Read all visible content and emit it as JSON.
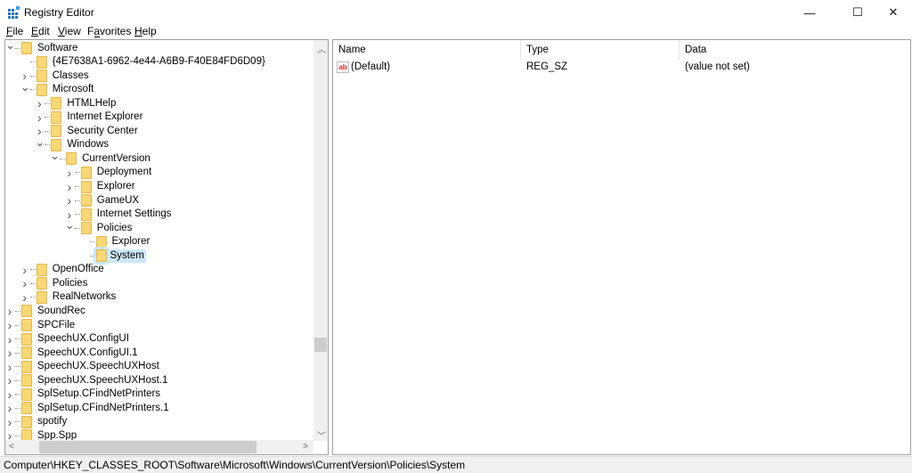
{
  "window": {
    "title": "Registry Editor",
    "minimize": "—",
    "maximize": "☐",
    "close": "✕"
  },
  "menu": [
    {
      "label": "File",
      "key": "F",
      "rest": "ile"
    },
    {
      "label": "Edit",
      "key": "E",
      "rest": "dit"
    },
    {
      "label": "View",
      "key": "V",
      "rest": "iew"
    },
    {
      "label": "Favorites",
      "key": "a",
      "pre": "F",
      "rest": "vorites"
    },
    {
      "label": "Help",
      "key": "H",
      "rest": "elp"
    }
  ],
  "tree": [
    {
      "level": 0,
      "exp": "open",
      "label": "Software"
    },
    {
      "level": 1,
      "exp": "none",
      "label": "{4E7638A1-6962-4e44-A6B9-F40E84FD6D09}"
    },
    {
      "level": 1,
      "exp": "closed",
      "label": "Classes"
    },
    {
      "level": 1,
      "exp": "open",
      "label": "Microsoft"
    },
    {
      "level": 2,
      "exp": "closed",
      "label": "HTMLHelp"
    },
    {
      "level": 2,
      "exp": "closed",
      "label": "Internet Explorer"
    },
    {
      "level": 2,
      "exp": "closed",
      "label": "Security Center"
    },
    {
      "level": 2,
      "exp": "open",
      "label": "Windows"
    },
    {
      "level": 3,
      "exp": "open",
      "label": "CurrentVersion"
    },
    {
      "level": 4,
      "exp": "closed",
      "label": "Deployment"
    },
    {
      "level": 4,
      "exp": "closed",
      "label": "Explorer"
    },
    {
      "level": 4,
      "exp": "closed",
      "label": "GameUX"
    },
    {
      "level": 4,
      "exp": "closed",
      "label": "Internet Settings"
    },
    {
      "level": 4,
      "exp": "open",
      "label": "Policies"
    },
    {
      "level": 5,
      "exp": "none",
      "label": "Explorer"
    },
    {
      "level": 5,
      "exp": "none",
      "label": "System",
      "selected": true
    },
    {
      "level": 1,
      "exp": "closed",
      "label": "OpenOffice"
    },
    {
      "level": 1,
      "exp": "closed",
      "label": "Policies"
    },
    {
      "level": 1,
      "exp": "closed",
      "label": "RealNetworks"
    },
    {
      "level": 0,
      "exp": "closed",
      "label": "SoundRec"
    },
    {
      "level": 0,
      "exp": "closed",
      "label": "SPCFile"
    },
    {
      "level": 0,
      "exp": "closed",
      "label": "SpeechUX.ConfigUI"
    },
    {
      "level": 0,
      "exp": "closed",
      "label": "SpeechUX.ConfigUI.1"
    },
    {
      "level": 0,
      "exp": "closed",
      "label": "SpeechUX.SpeechUXHost"
    },
    {
      "level": 0,
      "exp": "closed",
      "label": "SpeechUX.SpeechUXHost.1"
    },
    {
      "level": 0,
      "exp": "closed",
      "label": "SplSetup.CFindNetPrinters"
    },
    {
      "level": 0,
      "exp": "closed",
      "label": "SplSetup.CFindNetPrinters.1"
    },
    {
      "level": 0,
      "exp": "closed",
      "label": "spotify"
    },
    {
      "level": 0,
      "exp": "closed",
      "label": "Spp.Spp"
    }
  ],
  "list": {
    "columns": [
      "Name",
      "Type",
      "Data"
    ],
    "rows": [
      {
        "name": "(Default)",
        "type": "REG_SZ",
        "data": "(value not set)",
        "icon": "ab"
      }
    ]
  },
  "status": "Computer\\HKEY_CLASSES_ROOT\\Software\\Microsoft\\Windows\\CurrentVersion\\Policies\\System"
}
